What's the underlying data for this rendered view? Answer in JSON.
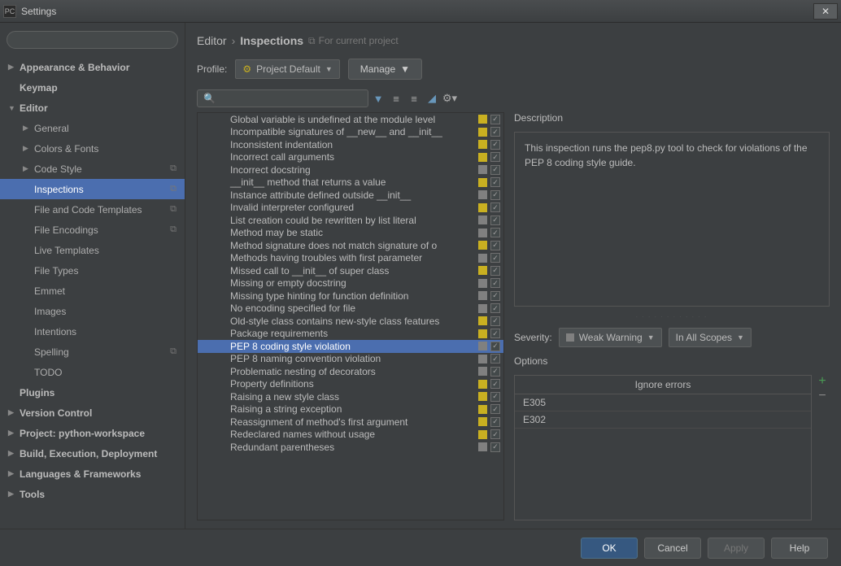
{
  "window": {
    "title": "Settings"
  },
  "breadcrumb": {
    "part1": "Editor",
    "part2": "Inspections",
    "hint": "For current project"
  },
  "profile": {
    "label": "Profile:",
    "value": "Project Default",
    "manage": "Manage"
  },
  "sidebar": {
    "items": [
      {
        "label": "Appearance & Behavior",
        "arrow": "closed",
        "bold": true,
        "depth": 0
      },
      {
        "label": "Keymap",
        "arrow": "none",
        "bold": true,
        "depth": 0
      },
      {
        "label": "Editor",
        "arrow": "open",
        "bold": true,
        "depth": 0
      },
      {
        "label": "General",
        "arrow": "closed",
        "bold": false,
        "depth": 1
      },
      {
        "label": "Colors & Fonts",
        "arrow": "closed",
        "bold": false,
        "depth": 1
      },
      {
        "label": "Code Style",
        "arrow": "closed",
        "bold": false,
        "depth": 1,
        "badge": "⧉"
      },
      {
        "label": "Inspections",
        "arrow": "none",
        "bold": false,
        "depth": 1,
        "selected": true,
        "badge": "⧉"
      },
      {
        "label": "File and Code Templates",
        "arrow": "none",
        "bold": false,
        "depth": 1,
        "badge": "⧉"
      },
      {
        "label": "File Encodings",
        "arrow": "none",
        "bold": false,
        "depth": 1,
        "badge": "⧉"
      },
      {
        "label": "Live Templates",
        "arrow": "none",
        "bold": false,
        "depth": 1
      },
      {
        "label": "File Types",
        "arrow": "none",
        "bold": false,
        "depth": 1
      },
      {
        "label": "Emmet",
        "arrow": "none",
        "bold": false,
        "depth": 1
      },
      {
        "label": "Images",
        "arrow": "none",
        "bold": false,
        "depth": 1
      },
      {
        "label": "Intentions",
        "arrow": "none",
        "bold": false,
        "depth": 1
      },
      {
        "label": "Spelling",
        "arrow": "none",
        "bold": false,
        "depth": 1,
        "badge": "⧉"
      },
      {
        "label": "TODO",
        "arrow": "none",
        "bold": false,
        "depth": 1
      },
      {
        "label": "Plugins",
        "arrow": "none",
        "bold": true,
        "depth": 0
      },
      {
        "label": "Version Control",
        "arrow": "closed",
        "bold": true,
        "depth": 0
      },
      {
        "label": "Project: python-workspace",
        "arrow": "closed",
        "bold": true,
        "depth": 0
      },
      {
        "label": "Build, Execution, Deployment",
        "arrow": "closed",
        "bold": true,
        "depth": 0
      },
      {
        "label": "Languages & Frameworks",
        "arrow": "closed",
        "bold": true,
        "depth": 0
      },
      {
        "label": "Tools",
        "arrow": "closed",
        "bold": true,
        "depth": 0
      }
    ]
  },
  "inspections": [
    {
      "label": "Global variable is undefined at the module level",
      "sev": "yellow"
    },
    {
      "label": "Incompatible signatures of __new__ and __init__",
      "sev": "yellow"
    },
    {
      "label": "Inconsistent indentation",
      "sev": "yellow"
    },
    {
      "label": "Incorrect call arguments",
      "sev": "yellow"
    },
    {
      "label": "Incorrect docstring",
      "sev": "gray"
    },
    {
      "label": "__init__ method that returns a value",
      "sev": "yellow"
    },
    {
      "label": "Instance attribute defined outside __init__",
      "sev": "gray"
    },
    {
      "label": "Invalid interpreter configured",
      "sev": "yellow"
    },
    {
      "label": "List creation could be rewritten by list literal",
      "sev": "gray"
    },
    {
      "label": "Method may be static",
      "sev": "gray"
    },
    {
      "label": "Method signature does not match signature of o",
      "sev": "yellow"
    },
    {
      "label": "Methods having troubles with first parameter",
      "sev": "gray"
    },
    {
      "label": "Missed call to __init__ of super class",
      "sev": "yellow"
    },
    {
      "label": "Missing or empty docstring",
      "sev": "gray"
    },
    {
      "label": "Missing type hinting for function definition",
      "sev": "gray"
    },
    {
      "label": "No encoding specified for file",
      "sev": "gray"
    },
    {
      "label": "Old-style class contains new-style class features",
      "sev": "yellow"
    },
    {
      "label": "Package requirements",
      "sev": "yellow"
    },
    {
      "label": "PEP 8 coding style violation",
      "sev": "gray",
      "selected": true
    },
    {
      "label": "PEP 8 naming convention violation",
      "sev": "gray"
    },
    {
      "label": "Problematic nesting of decorators",
      "sev": "gray"
    },
    {
      "label": "Property definitions",
      "sev": "yellow"
    },
    {
      "label": "Raising a new style class",
      "sev": "yellow"
    },
    {
      "label": "Raising a string exception",
      "sev": "yellow"
    },
    {
      "label": "Reassignment of method's first argument",
      "sev": "yellow"
    },
    {
      "label": "Redeclared names without usage",
      "sev": "yellow"
    },
    {
      "label": "Redundant parentheses",
      "sev": "gray"
    }
  ],
  "description": {
    "label": "Description",
    "text": "This inspection runs the pep8.py tool to check for violations of the PEP 8 coding style guide."
  },
  "severity": {
    "label": "Severity:",
    "value": "Weak Warning",
    "scope": "In All Scopes"
  },
  "options": {
    "label": "Options",
    "header": "Ignore errors",
    "items": [
      "E305",
      "E302"
    ]
  },
  "footer": {
    "ok": "OK",
    "cancel": "Cancel",
    "apply": "Apply",
    "help": "Help"
  }
}
